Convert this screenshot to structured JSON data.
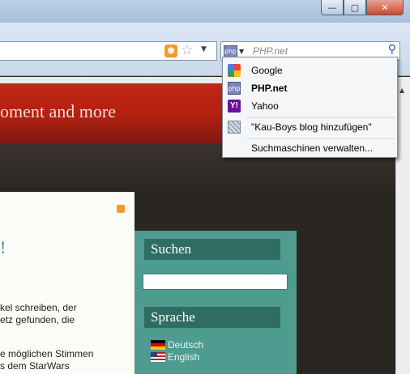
{
  "window": {
    "minimize": "—",
    "maximize": "▢",
    "close": "✕"
  },
  "search": {
    "placeholder": "PHP.net",
    "engine_icon_label": "php"
  },
  "page": {
    "banner_title": "oment and more",
    "exclaim": "!",
    "content_lines": [
      "kel schreiben, der",
      "etz gefunden, die",
      "e möglichen Stimmen",
      "s dem StarWars"
    ],
    "sidebar": {
      "search_heading": "Suchen",
      "language_heading": "Sprache",
      "languages": [
        "Deutsch",
        "English"
      ]
    }
  },
  "dropdown": {
    "engines": [
      {
        "label": "Google",
        "icon": "google-icon",
        "selected": false
      },
      {
        "label": "PHP.net",
        "icon": "php-icon",
        "selected": true
      },
      {
        "label": "Yahoo",
        "icon": "yahoo-icon",
        "selected": false
      }
    ],
    "add_engine": "\"Kau-Boys blog hinzufügen\"",
    "manage": "Suchmaschinen verwalten..."
  }
}
